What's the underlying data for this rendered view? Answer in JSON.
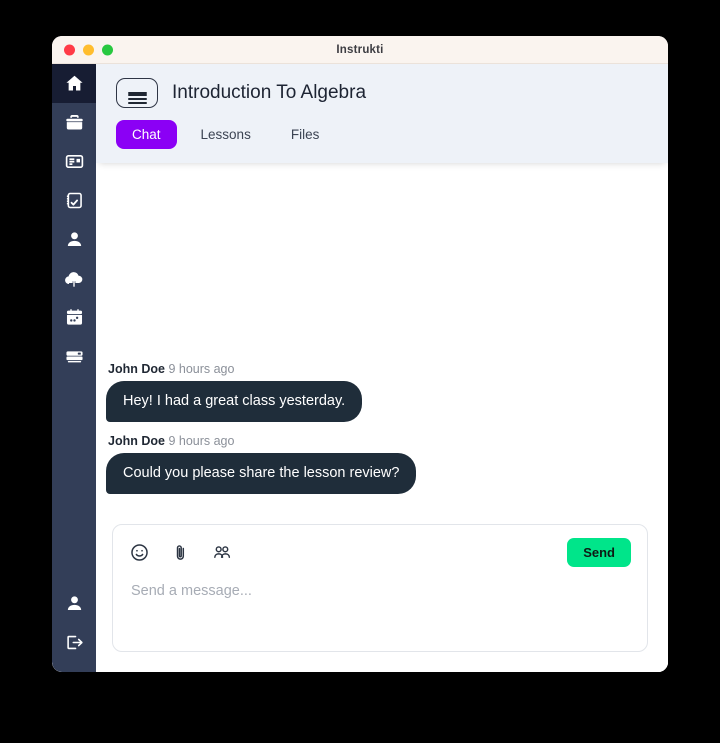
{
  "window": {
    "title": "Instrukti",
    "traffic_lights": [
      {
        "name": "close",
        "color": "#ff3b47"
      },
      {
        "name": "minimize",
        "color": "#ffbd2e"
      },
      {
        "name": "maximize",
        "color": "#28c840"
      }
    ]
  },
  "colors": {
    "accent_purple": "#8b00f5",
    "send_green": "#00e58a",
    "sidebar": "#333e58",
    "sidebar_active": "#171d33",
    "header_bg": "#eef2f8",
    "bubble_bg": "#1f2d3a",
    "page_bg": "#000000"
  },
  "sidebar": {
    "top_items": [
      {
        "icon": "home-icon",
        "label": "Home",
        "active": true
      },
      {
        "icon": "briefcase-icon",
        "label": "Courses",
        "active": false
      },
      {
        "icon": "article-card-icon",
        "label": "News",
        "active": false
      },
      {
        "icon": "clipboard-check-icon",
        "label": "Assignments",
        "active": false
      },
      {
        "icon": "person-icon",
        "label": "Students",
        "active": false
      },
      {
        "icon": "cloud-upload-icon",
        "label": "Uploads",
        "active": false
      },
      {
        "icon": "calendar-icon",
        "label": "Calendar",
        "active": false
      },
      {
        "icon": "credit-card-icon",
        "label": "Billing",
        "active": false
      }
    ],
    "bottom_items": [
      {
        "icon": "person-icon",
        "label": "Profile"
      },
      {
        "icon": "logout-icon",
        "label": "Log out"
      }
    ]
  },
  "header": {
    "menu_icon": "hamburger-icon",
    "title": "Introduction To Algebra",
    "tabs": [
      {
        "label": "Chat",
        "active": true
      },
      {
        "label": "Lessons",
        "active": false
      },
      {
        "label": "Files",
        "active": false
      }
    ]
  },
  "chat": {
    "messages": [
      {
        "author": "John Doe",
        "time": "9 hours ago",
        "text": "Hey! I had a great class yesterday."
      },
      {
        "author": "John Doe",
        "time": "9 hours ago",
        "text": "Could you please share the lesson review?"
      }
    ]
  },
  "composer": {
    "tools": [
      {
        "icon": "emoji-icon",
        "label": "Emoji"
      },
      {
        "icon": "paperclip-icon",
        "label": "Attach file"
      },
      {
        "icon": "people-group-icon",
        "label": "Mention people"
      }
    ],
    "send_label": "Send",
    "placeholder": "Send a message...",
    "value": ""
  }
}
